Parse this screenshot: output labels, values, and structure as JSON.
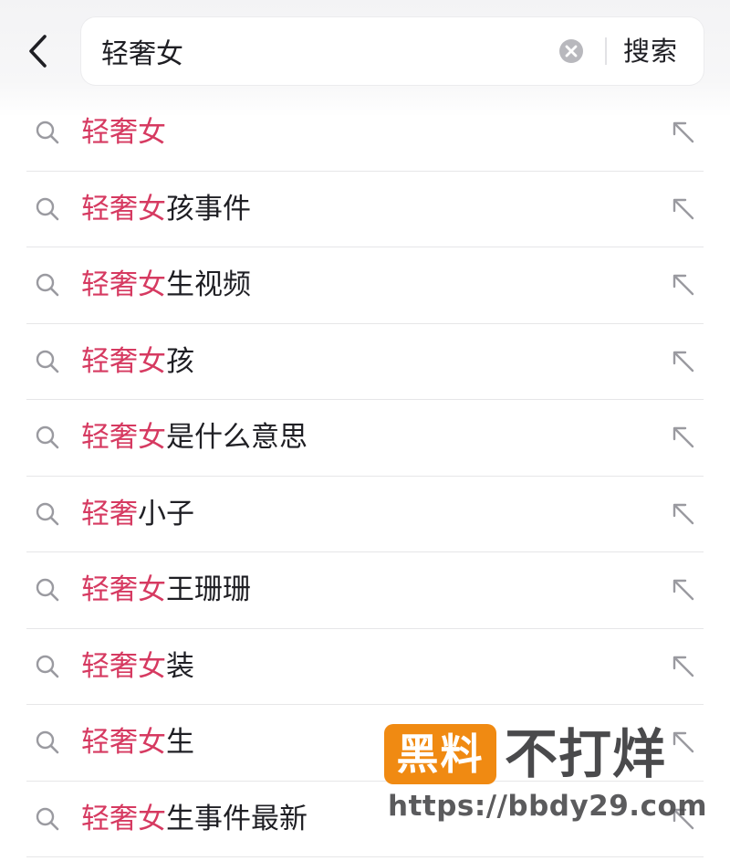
{
  "header": {
    "back_icon": "chevron-left-icon",
    "search_value": "轻奢女",
    "clear_icon": "clear-circle-icon",
    "search_button": "搜索"
  },
  "suggestions": [
    {
      "highlight": "轻奢女",
      "rest": ""
    },
    {
      "highlight": "轻奢女",
      "rest": "孩事件"
    },
    {
      "highlight": "轻奢女",
      "rest": "生视频"
    },
    {
      "highlight": "轻奢女",
      "rest": "孩"
    },
    {
      "highlight": "轻奢女",
      "rest": "是什么意思"
    },
    {
      "highlight": "轻奢",
      "rest": "小子"
    },
    {
      "highlight": "轻奢女",
      "rest": "王珊珊"
    },
    {
      "highlight": "轻奢女",
      "rest": "装"
    },
    {
      "highlight": "轻奢女",
      "rest": "生"
    },
    {
      "highlight": "轻奢女",
      "rest": "生事件最新"
    }
  ],
  "icons": {
    "row_leading": "search-icon",
    "row_trailing": "fill-arrow-up-left-icon"
  },
  "colors": {
    "highlight": "#d63a61",
    "text": "#1f1f24",
    "watermark_badge": "#f08a12"
  },
  "watermark": {
    "badge": "黑料",
    "title": "不打烊",
    "url": "https://bbdy29.com"
  }
}
